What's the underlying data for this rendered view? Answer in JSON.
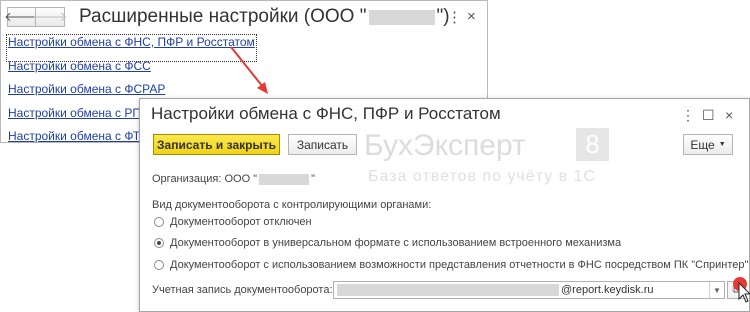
{
  "background_window": {
    "back_icon": "arrow-left",
    "forward_icon": "arrow-right",
    "title_prefix": "Расширенные настройки (ООО \"",
    "title_suffix": "\")",
    "more_glyph": "⋮",
    "close_glyph": "×",
    "links": [
      "Настройки обмена с ФНС, ПФР и Росстатом",
      "Настройки обмена с ФСС",
      "Настройки обмена с ФСРАР",
      "Настройки обмена с РПН",
      "Настройки обмена с ФТС"
    ]
  },
  "dialog": {
    "title": "Настройки обмена с ФНС, ПФР и Росстатом",
    "controls": {
      "more": "⋮",
      "maximize": "☐",
      "close": "×"
    },
    "buttons": {
      "save_close": "Записать и закрыть",
      "save": "Записать",
      "more": "Еще"
    },
    "watermark": {
      "brand": "БухЭксперт",
      "number": "8",
      "subtitle": "База ответов по учёту в 1С"
    },
    "organization_label": "Организация: ООО \"",
    "organization_suffix": "\"",
    "docflow_label": "Вид документооборота с контролирующими органами:",
    "options": [
      {
        "label": "Документооборот отключен",
        "selected": false
      },
      {
        "label": "Документооборот в универсальном формате с использованием встроенного механизма",
        "selected": true
      },
      {
        "label": "Документооборот с использованием возможности представления отчетности в ФНС посредством ПК \"Спринтер\"",
        "selected": false
      }
    ],
    "account_label": "Учетная запись документооборота:",
    "account_value": "@report.keydisk.ru"
  },
  "colors": {
    "link": "#1f3ea6",
    "primary_button": "#f5dc2a",
    "arrow": "#e53935"
  }
}
